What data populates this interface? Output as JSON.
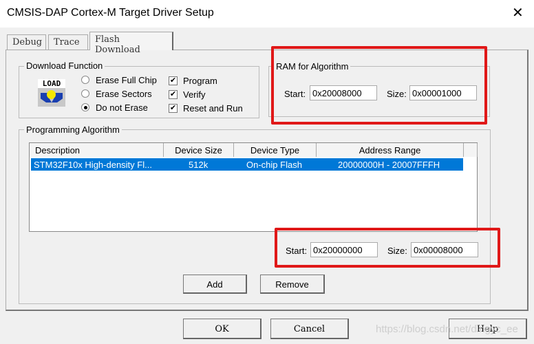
{
  "window": {
    "title": "CMSIS-DAP Cortex-M Target Driver Setup",
    "close": "✕"
  },
  "tabs": [
    {
      "label": "Debug"
    },
    {
      "label": "Trace"
    },
    {
      "label": "Flash Download"
    }
  ],
  "download_function": {
    "label": "Download Function",
    "icon_text": "LOAD",
    "radios": [
      {
        "label": "Erase Full Chip",
        "checked": false
      },
      {
        "label": "Erase Sectors",
        "checked": false
      },
      {
        "label": "Do not Erase",
        "checked": true
      }
    ],
    "checks": [
      {
        "label": "Program",
        "checked": true
      },
      {
        "label": "Verify",
        "checked": true
      },
      {
        "label": "Reset and Run",
        "checked": true
      }
    ],
    "check_mark": "✔"
  },
  "ram": {
    "label": "RAM for Algorithm",
    "start_label": "Start:",
    "start": "0x20008000",
    "size_label": "Size:",
    "size": "0x00001000"
  },
  "prog": {
    "label": "Programming Algorithm",
    "columns": [
      "Description",
      "Device Size",
      "Device Type",
      "Address Range"
    ],
    "rows": [
      {
        "desc": "STM32F10x High-density Fl...",
        "size": "512k",
        "type": "On-chip Flash",
        "range": "20000000H - 20007FFFH"
      }
    ],
    "start_label": "Start:",
    "start": "0x20000000",
    "size_label": "Size:",
    "size": "0x00008000",
    "add": "Add",
    "remove": "Remove"
  },
  "buttons": {
    "ok": "OK",
    "cancel": "Cancel",
    "help": "Help"
  },
  "watermark": "https://blog.csdn.net/dingyc_ee",
  "colors": {
    "highlight": "#0078d7",
    "annotation": "#e01818"
  }
}
